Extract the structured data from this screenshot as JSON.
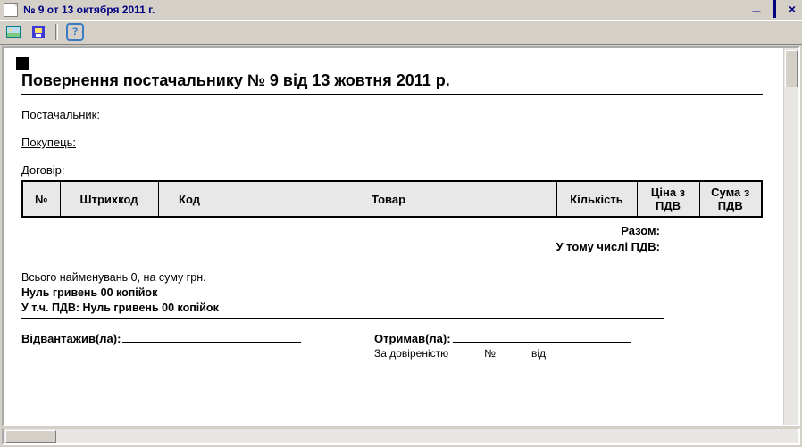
{
  "window": {
    "title": "№ 9 от 13 октября 2011 г."
  },
  "document": {
    "title": "Повернення постачальнику № 9 від 13 жовтня 2011 р.",
    "supplier_label": "Постачальник:",
    "buyer_label": "Покупець:",
    "contract_label": "Договір:",
    "totals": {
      "sum_label": "Разом:",
      "vat_label": "У тому числі ПДВ:"
    },
    "summary": {
      "line1": "Всього найменувань 0, на суму  грн.",
      "line2": "Нуль гривень 00 копійок",
      "line3": "У т.ч. ПДВ: Нуль гривень 00 копійок"
    },
    "signatures": {
      "shipped_label": "Відвантажив(ла):",
      "received_label": "Отримав(ла):",
      "by_proxy": "За довіреністю",
      "proxy_no": "№",
      "proxy_from": "від"
    }
  },
  "table": {
    "headers": [
      "№",
      "Штрихкод",
      "Код",
      "Товар",
      "Кількість",
      "Ціна з ПДВ",
      "Сума з ПДВ"
    ]
  },
  "icons": {
    "help": "?"
  }
}
